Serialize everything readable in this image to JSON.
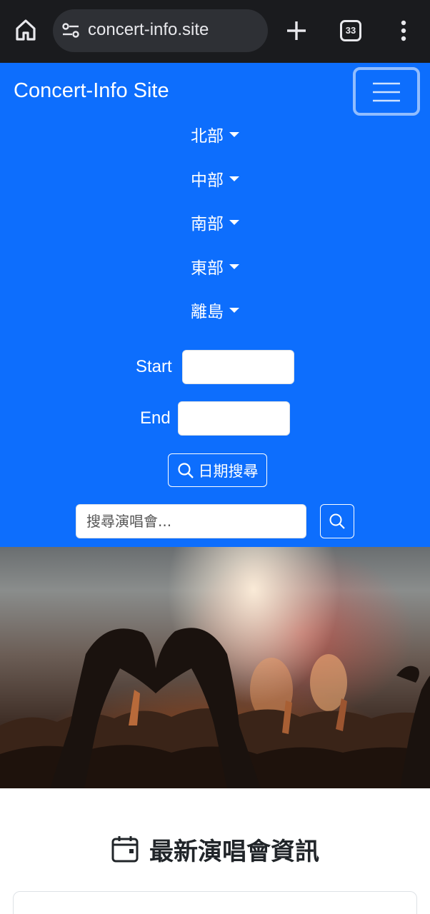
{
  "browser": {
    "url": "concert-info.site",
    "tab_count": "33",
    "icons": [
      "home-icon",
      "site-settings-icon",
      "new-tab-icon",
      "tabs-icon",
      "more-menu-icon"
    ]
  },
  "navbar": {
    "brand": "Concert-Info Site",
    "regions": [
      "北部",
      "中部",
      "南部",
      "東部",
      "離島"
    ],
    "start_label": "Start",
    "end_label": "End",
    "date_search_label": "日期搜尋",
    "search_placeholder": "搜尋演唱會...",
    "color": "#0d6efd"
  },
  "hero": {
    "description_icon": "concert-crowd-heart-hands-image"
  },
  "main": {
    "section_title": "最新演唱會資訊",
    "section_icon": "calendar-icon"
  }
}
